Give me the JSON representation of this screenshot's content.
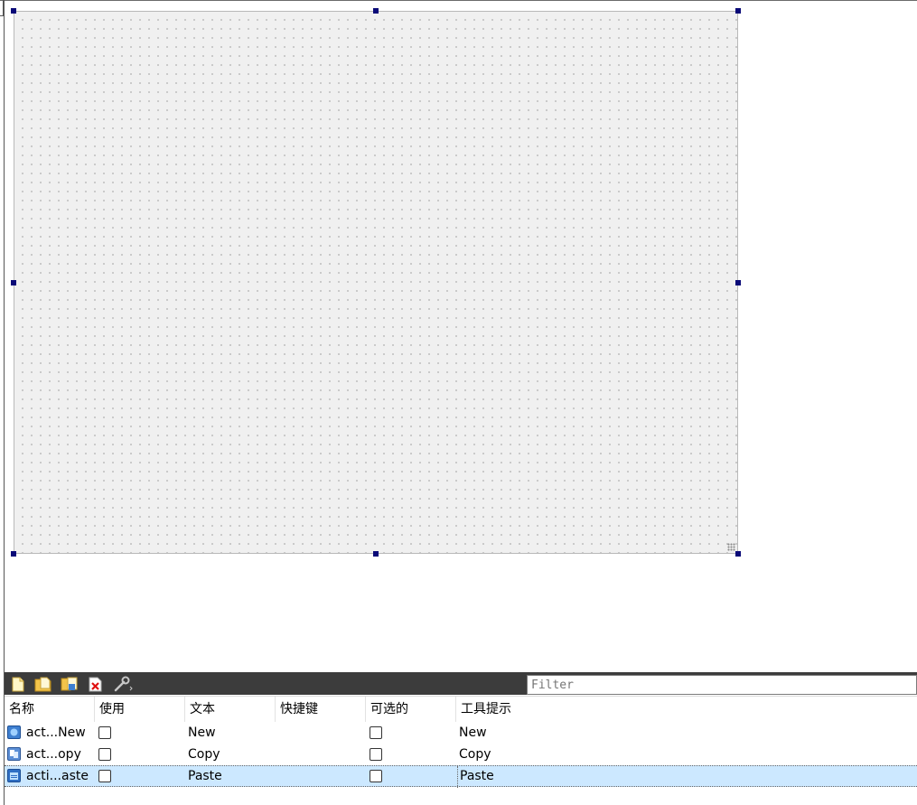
{
  "toolbar": {
    "buttons": [
      {
        "name": "new-action-icon",
        "tooltip": ""
      },
      {
        "name": "open-folder-icon",
        "tooltip": ""
      },
      {
        "name": "copy-action-icon",
        "tooltip": ""
      },
      {
        "name": "delete-action-icon",
        "tooltip": ""
      },
      {
        "name": "settings-wrench-icon",
        "tooltip": ""
      }
    ],
    "filter_placeholder": "Filter"
  },
  "table": {
    "columns": [
      "名称",
      "使用",
      "文本",
      "快捷键",
      "可选的",
      "工具提示"
    ],
    "rows": [
      {
        "name": "act...New",
        "used": false,
        "text": "New",
        "shortcut": "",
        "checkable": false,
        "tooltip": "New",
        "icon": "new-doc-icon"
      },
      {
        "name": "act...opy",
        "used": false,
        "text": "Copy",
        "shortcut": "",
        "checkable": false,
        "tooltip": "Copy",
        "icon": "copy-doc-icon"
      },
      {
        "name": "acti...aste",
        "used": false,
        "text": "Paste",
        "shortcut": "",
        "checkable": false,
        "tooltip": "Paste",
        "icon": "paste-doc-icon",
        "selected": true
      }
    ]
  },
  "colors": {
    "toolbar_bg": "#3c3c3c",
    "selection_bg": "#cce8ff",
    "handle": "#0a0a78",
    "canvas_bg": "#f0f0f0"
  }
}
